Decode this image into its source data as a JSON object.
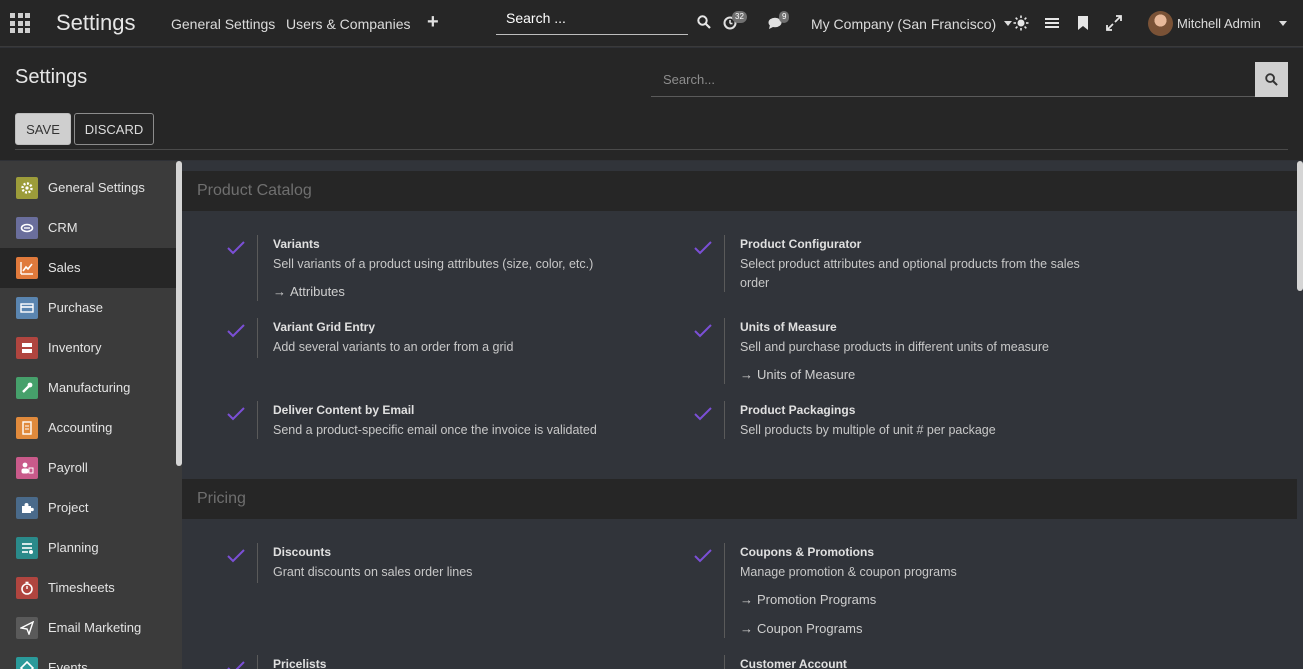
{
  "topbar": {
    "brand": "Settings",
    "menu": [
      "General Settings",
      "Users & Companies"
    ],
    "search_placeholder": "Search ...",
    "activity_count": "32",
    "message_count": "9",
    "company": "My Company (San Francisco)",
    "user": "Mitchell Admin"
  },
  "control_panel": {
    "title": "Settings",
    "search_placeholder": "Search...",
    "save_label": "SAVE",
    "discard_label": "DISCARD"
  },
  "sidebar": {
    "items": [
      {
        "label": "General Settings",
        "icon": "gear-icon",
        "color": "#9c9c3a"
      },
      {
        "label": "CRM",
        "icon": "handshake-icon",
        "color": "#6a6e9c"
      },
      {
        "label": "Sales",
        "icon": "chart-icon",
        "color": "#e07a3c"
      },
      {
        "label": "Purchase",
        "icon": "card-icon",
        "color": "#5a85b0"
      },
      {
        "label": "Inventory",
        "icon": "boxes-icon",
        "color": "#b0453f"
      },
      {
        "label": "Manufacturing",
        "icon": "wrench-icon",
        "color": "#46a06b"
      },
      {
        "label": "Accounting",
        "icon": "document-icon",
        "color": "#e08a3c"
      },
      {
        "label": "Payroll",
        "icon": "people-icon",
        "color": "#c95a8a"
      },
      {
        "label": "Project",
        "icon": "puzzle-icon",
        "color": "#4a6a8a"
      },
      {
        "label": "Planning",
        "icon": "list-icon",
        "color": "#2a8a8a"
      },
      {
        "label": "Timesheets",
        "icon": "stopwatch-icon",
        "color": "#b0453f"
      },
      {
        "label": "Email Marketing",
        "icon": "paper-plane-icon",
        "color": "#5a5a5a"
      },
      {
        "label": "Events",
        "icon": "ticket-icon",
        "color": "#2a9a9a"
      }
    ],
    "active_index": 2
  },
  "sections": [
    {
      "title": "Product Catalog",
      "settings": [
        {
          "title": "Variants",
          "desc": "Sell variants of a product using attributes (size, color, etc.)",
          "links": [
            "Attributes"
          ]
        },
        {
          "title": "Product Configurator",
          "desc": "Select product attributes and optional products from the sales order",
          "links": []
        },
        {
          "title": "Variant Grid Entry",
          "desc": "Add several variants to an order from a grid",
          "links": []
        },
        {
          "title": "Units of Measure",
          "desc": "Sell and purchase products in different units of measure",
          "links": [
            "Units of Measure"
          ]
        },
        {
          "title": "Deliver Content by Email",
          "desc": "Send a product-specific email once the invoice is validated",
          "links": []
        },
        {
          "title": "Product Packagings",
          "desc": "Sell products by multiple of unit # per package",
          "links": []
        }
      ]
    },
    {
      "title": "Pricing",
      "settings": [
        {
          "title": "Discounts",
          "desc": "Grant discounts on sales order lines",
          "links": []
        },
        {
          "title": "Coupons & Promotions",
          "desc": "Manage promotion & coupon programs",
          "links": [
            "Promotion Programs",
            "Coupon Programs"
          ]
        },
        {
          "title": "Pricelists",
          "desc": "",
          "links": []
        },
        {
          "title": "Customer Account",
          "desc": "",
          "links": []
        }
      ]
    }
  ],
  "colors": {
    "check": "#7b4fd6",
    "active_sidebar": "#262626",
    "section_header": "#262626"
  }
}
